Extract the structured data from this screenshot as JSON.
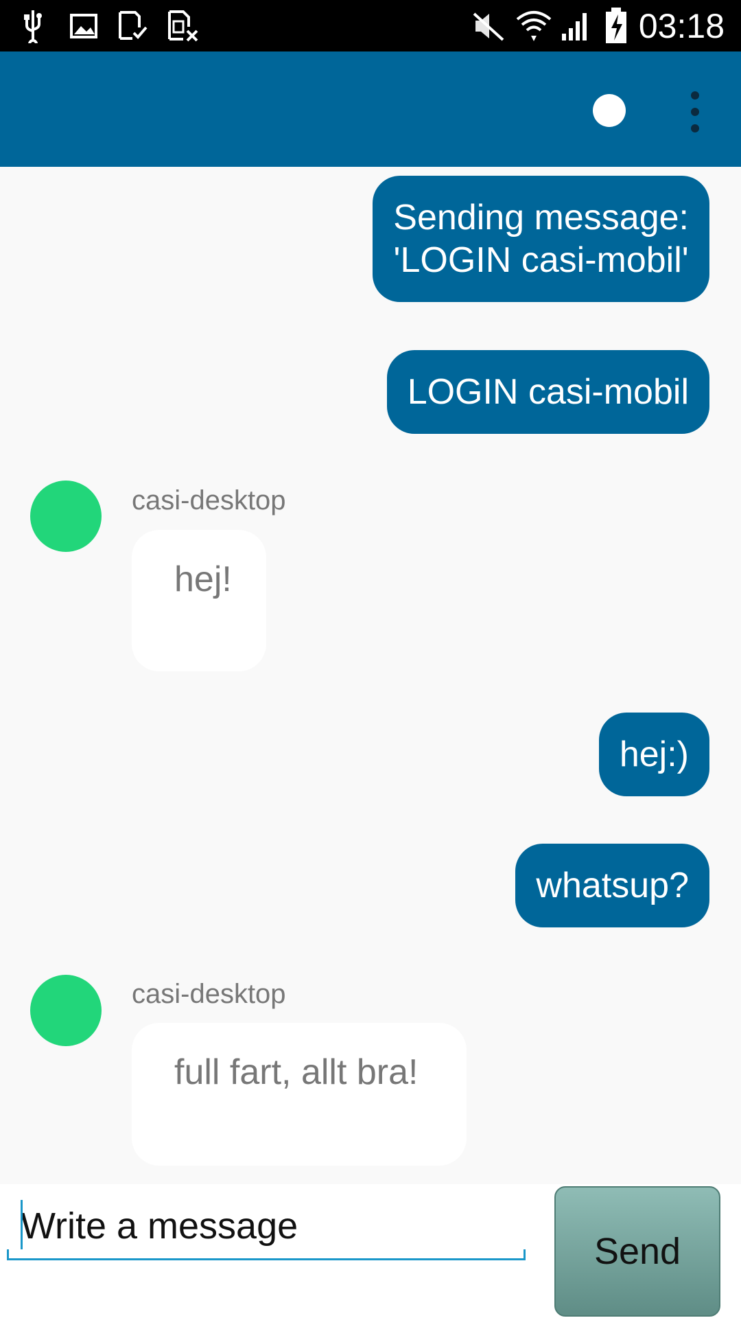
{
  "status_bar": {
    "time": "03:18",
    "left_icons": [
      "usb-icon",
      "image-icon",
      "sd-card-check-icon",
      "sim-card-x-icon"
    ],
    "right_icons": [
      "mute-icon",
      "wifi-icon",
      "signal-icon",
      "battery-charging-icon"
    ]
  },
  "app_bar": {
    "background": "#006699",
    "status_indicator_color": "#ffffff",
    "menu_icon": "more-vert-icon"
  },
  "messages": [
    {
      "direction": "outgoing",
      "lines": [
        "Sending message:",
        "'LOGIN casi-mobil'"
      ]
    },
    {
      "direction": "outgoing",
      "text": "LOGIN casi-mobil"
    },
    {
      "direction": "incoming",
      "sender": "casi-desktop",
      "text": "hej!"
    },
    {
      "direction": "outgoing",
      "text": "hej:)"
    },
    {
      "direction": "outgoing",
      "text": "whatsup?"
    },
    {
      "direction": "incoming",
      "sender": "casi-desktop",
      "text": "full fart, allt bra!"
    }
  ],
  "colors": {
    "outgoing_bubble": "#006699",
    "incoming_bubble": "#ffffff",
    "avatar": "#22d67a",
    "accent": "#1a97c9"
  },
  "composer": {
    "placeholder": "Write a message",
    "value": "",
    "send_label": "Send"
  }
}
